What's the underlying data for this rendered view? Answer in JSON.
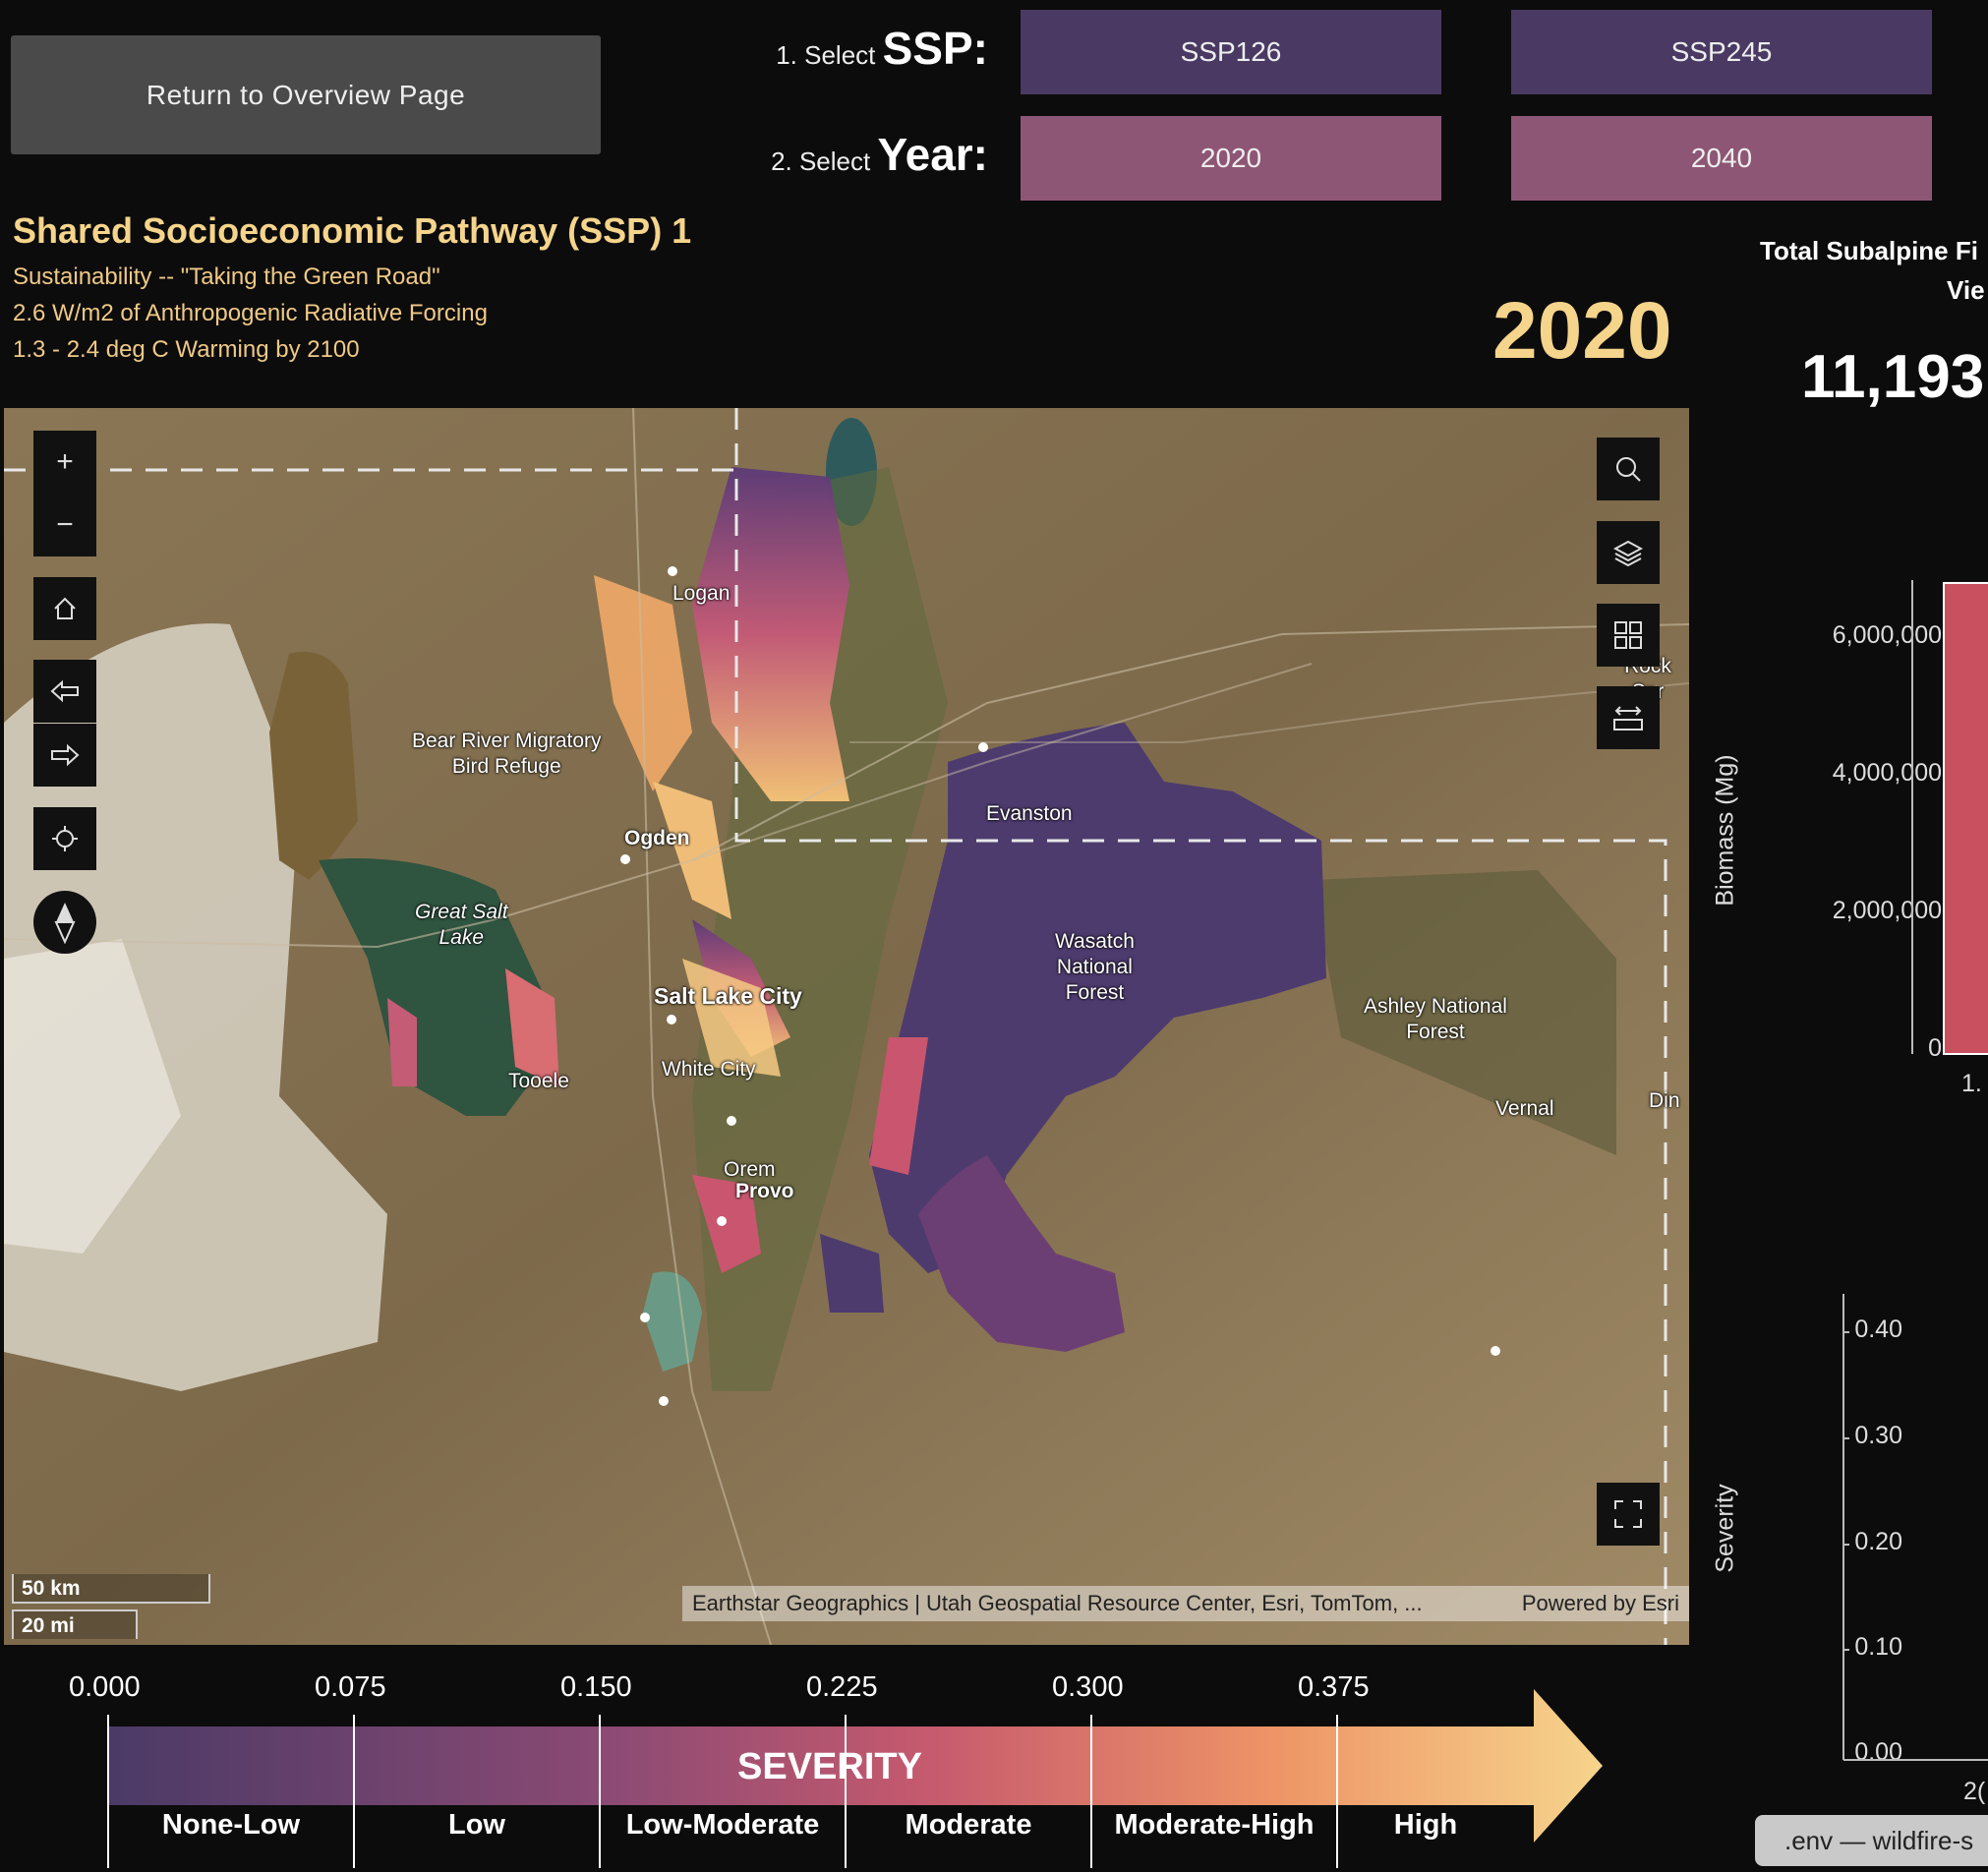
{
  "nav": {
    "overview_button": "Return to Overview Page"
  },
  "selectors": {
    "ssp": {
      "prefix": "1. Select",
      "label": "SSP:",
      "options": [
        "SSP126",
        "SSP245"
      ]
    },
    "year": {
      "prefix": "2. Select",
      "label": "Year:",
      "options": [
        "2020",
        "2040"
      ]
    }
  },
  "scenario": {
    "title": "Shared Socioeconomic Pathway (SSP) 1",
    "lines": [
      "Sustainability -- \"Taking the Green Road\"",
      "2.6 W/m2 of Anthropogenic Radiative Forcing",
      "1.3 - 2.4 deg C Warming by 2100"
    ]
  },
  "current_year": "2020",
  "side_panel": {
    "title_line1": "Total Subalpine Fi",
    "title_line2": "Vie",
    "total_value": "11,193"
  },
  "map": {
    "labels": {
      "logan": "Logan",
      "bear_river": "Bear River Migratory\nBird Refuge",
      "ogden": "Ogden",
      "great_salt_lake": "Great Salt\nLake",
      "salt_lake_city": "Salt Lake City",
      "white_city": "White City",
      "tooele": "Tooele",
      "orem": "Orem",
      "provo": "Provo",
      "evanston": "Evanston",
      "wasatch": "Wasatch\nNational\nForest",
      "ashley": "Ashley National\nForest",
      "vernal": "Vernal",
      "rock_springs": "Rock Spr",
      "dinosaur": "Din"
    },
    "scale": {
      "km": "50 km",
      "mi": "20 mi"
    },
    "attribution": "Earthstar Geographics | Utah Geospatial Resource Center, Esri, TomTom, ...",
    "powered_by": "Powered by Esri",
    "controls": {
      "zoom_in": "+",
      "zoom_out": "−"
    }
  },
  "legend": {
    "title": "SEVERITY",
    "ticks": [
      "0.000",
      "0.075",
      "0.150",
      "0.225",
      "0.300",
      "0.375"
    ],
    "categories": [
      "None-Low",
      "Low",
      "Low-Moderate",
      "Moderate",
      "Moderate-High",
      "High"
    ]
  },
  "chart_data": [
    {
      "type": "bar",
      "ylabel": "Biomass (Mg)",
      "yticks": [
        "6,000,000",
        "4,000,000",
        "2,000,000",
        "0"
      ],
      "categories": [
        "1."
      ],
      "values": [
        6700000
      ],
      "ylim": [
        0,
        7000000
      ],
      "color": "#c8505f"
    },
    {
      "type": "bar",
      "ylabel": "Severity",
      "yticks": [
        "0.40",
        "0.30",
        "0.20",
        "0.10",
        "0.00"
      ],
      "categories": [
        "2("
      ],
      "values": [],
      "ylim": [
        0,
        0.44
      ]
    }
  ],
  "taskbar": {
    "label": ".env — wildfire-s"
  },
  "colors": {
    "accent": "#f5d48b",
    "ssp_button": "#4a3a63",
    "year_button": "#8e5675",
    "bar": "#c8505f"
  }
}
